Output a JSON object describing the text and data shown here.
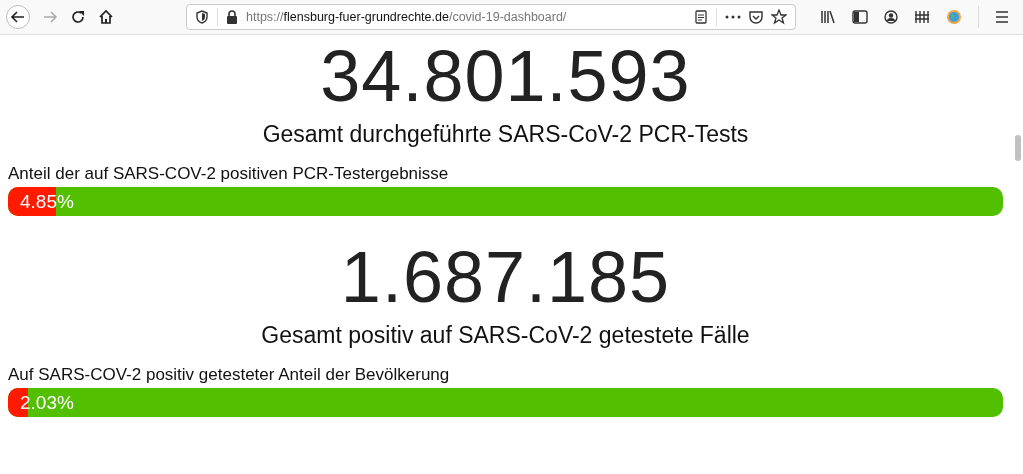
{
  "browser": {
    "url": {
      "scheme": "https://",
      "host": "flensburg-fuer-grundrechte.de",
      "path": "/covid-19-dashboard/"
    }
  },
  "stats": [
    {
      "value": "34.801.593",
      "caption": "Gesamt durchgeführte SARS-CoV-2 PCR-Tests",
      "bar_label": "Anteil der auf SARS-COV-2 positiven PCR-Testergebnisse",
      "percent": "4.85%",
      "level": 0.0485
    },
    {
      "value": "1.687.185",
      "caption": "Gesamt positiv auf SARS-CoV-2 getestete Fälle",
      "bar_label": "Auf SARS-COV-2 positiv getesteter Anteil der Bevölkerung",
      "percent": "2.03%",
      "level": 0.0203
    }
  ]
}
